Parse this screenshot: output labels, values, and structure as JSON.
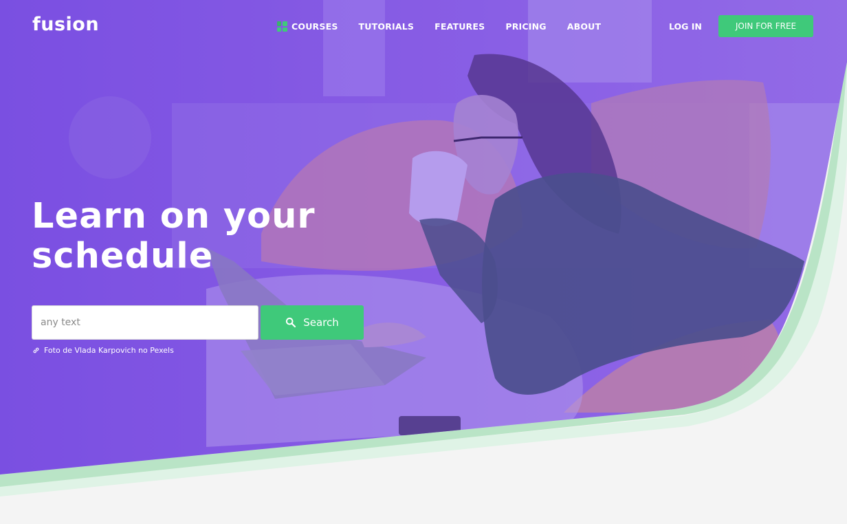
{
  "header": {
    "logo": "fusion",
    "nav": [
      {
        "label": "COURSES",
        "icon": "grid-icon"
      },
      {
        "label": "TUTORIALS"
      },
      {
        "label": "FEATURES"
      },
      {
        "label": "PRICING"
      },
      {
        "label": "ABOUT"
      }
    ],
    "login_label": "LOG IN",
    "join_label": "JOIN FOR FREE"
  },
  "hero": {
    "title_line1": "Learn on your",
    "title_line2": "schedule",
    "search": {
      "placeholder": "any text",
      "value": "",
      "button_label": "Search",
      "button_icon": "search-icon"
    },
    "photo_credit": "Foto de Vlada Karpovich no Pexels",
    "photo_credit_icon": "link-icon"
  },
  "colors": {
    "overlay": "#7b4fe0",
    "accent": "#3fc97a",
    "wave_light": "#dff3e6",
    "wave_mid": "#b9e4c6",
    "page_bg": "#f4f4f4"
  }
}
